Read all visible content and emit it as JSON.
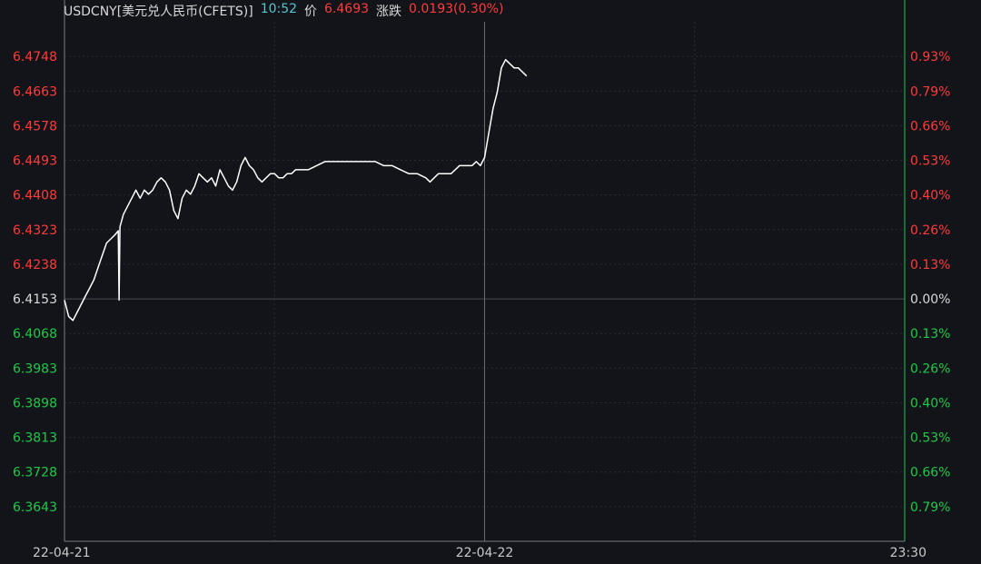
{
  "header": {
    "symbol": "USDCNY[美元兑人民币(CFETS)]",
    "time": "10:52",
    "price_label": "价",
    "price": "6.4693",
    "change_label": "涨跌",
    "change": "0.0193(0.30%)"
  },
  "colors": {
    "background": "#131419",
    "up": "#ff3b3b",
    "down": "#1ec94a",
    "neutral": "#d9d9d9",
    "line": "#ffffff",
    "grid": "#2a2c33",
    "time": "#56c5d0"
  },
  "chart_data": {
    "type": "line",
    "base_price": 6.4153,
    "ylim": [
      6.3558,
      6.4833
    ],
    "y_ticks_left": [
      "6.4748",
      "6.4663",
      "6.4578",
      "6.4493",
      "6.4408",
      "6.4323",
      "6.4238",
      "6.4153",
      "6.4068",
      "6.3983",
      "6.3898",
      "6.3813",
      "6.3728",
      "6.3643"
    ],
    "y_ticks_right": [
      "0.93%",
      "0.79%",
      "0.66%",
      "0.53%",
      "0.40%",
      "0.26%",
      "0.13%",
      "0.00%",
      "0.13%",
      "0.26%",
      "0.40%",
      "0.53%",
      "0.66%",
      "0.79%"
    ],
    "x_ticks": [
      "22-04-21",
      "22-04-22",
      "23:30"
    ],
    "x_range": [
      0,
      100
    ],
    "day_divider_x": 50,
    "grid": true,
    "series": [
      {
        "values": [
          [
            0.0,
            6.415
          ],
          [
            0.5,
            6.411
          ],
          [
            1.0,
            6.41
          ],
          [
            1.5,
            6.412
          ],
          [
            2.0,
            6.414
          ],
          [
            2.5,
            6.416
          ],
          [
            3.0,
            6.418
          ],
          [
            3.5,
            6.42
          ],
          [
            4.0,
            6.423
          ],
          [
            4.5,
            6.426
          ],
          [
            5.0,
            6.429
          ],
          [
            5.5,
            6.43
          ],
          [
            6.0,
            6.431
          ],
          [
            6.4,
            6.432
          ],
          [
            6.5,
            6.415
          ],
          [
            6.6,
            6.433
          ],
          [
            7.0,
            6.436
          ],
          [
            7.5,
            6.438
          ],
          [
            8.0,
            6.44
          ],
          [
            8.5,
            6.442
          ],
          [
            9.0,
            6.44
          ],
          [
            9.5,
            6.442
          ],
          [
            10.0,
            6.441
          ],
          [
            10.5,
            6.442
          ],
          [
            11.0,
            6.444
          ],
          [
            11.5,
            6.445
          ],
          [
            12.0,
            6.444
          ],
          [
            12.5,
            6.442
          ],
          [
            13.0,
            6.437
          ],
          [
            13.5,
            6.435
          ],
          [
            14.0,
            6.44
          ],
          [
            14.5,
            6.442
          ],
          [
            15.0,
            6.441
          ],
          [
            15.5,
            6.443
          ],
          [
            16.0,
            6.446
          ],
          [
            16.5,
            6.445
          ],
          [
            17.0,
            6.444
          ],
          [
            17.5,
            6.445
          ],
          [
            18.0,
            6.443
          ],
          [
            18.5,
            6.447
          ],
          [
            19.0,
            6.445
          ],
          [
            19.5,
            6.443
          ],
          [
            20.0,
            6.442
          ],
          [
            20.5,
            6.444
          ],
          [
            21.0,
            6.448
          ],
          [
            21.5,
            6.45
          ],
          [
            22.0,
            6.448
          ],
          [
            22.5,
            6.447
          ],
          [
            23.0,
            6.445
          ],
          [
            23.5,
            6.444
          ],
          [
            24.0,
            6.445
          ],
          [
            24.5,
            6.446
          ],
          [
            25.0,
            6.446
          ],
          [
            25.5,
            6.445
          ],
          [
            26.0,
            6.445
          ],
          [
            26.5,
            6.446
          ],
          [
            27.0,
            6.446
          ],
          [
            27.5,
            6.447
          ],
          [
            28.0,
            6.447
          ],
          [
            28.5,
            6.447
          ],
          [
            29.0,
            6.447
          ],
          [
            30.0,
            6.448
          ],
          [
            31.0,
            6.449
          ],
          [
            32.0,
            6.449
          ],
          [
            33.0,
            6.449
          ],
          [
            34.0,
            6.449
          ],
          [
            35.0,
            6.449
          ],
          [
            36.0,
            6.449
          ],
          [
            37.0,
            6.449
          ],
          [
            38.0,
            6.448
          ],
          [
            39.0,
            6.448
          ],
          [
            40.0,
            6.447
          ],
          [
            41.0,
            6.446
          ],
          [
            42.0,
            6.446
          ],
          [
            43.0,
            6.445
          ],
          [
            43.5,
            6.444
          ],
          [
            44.0,
            6.445
          ],
          [
            44.5,
            6.446
          ],
          [
            45.0,
            6.446
          ],
          [
            45.5,
            6.446
          ],
          [
            46.0,
            6.446
          ],
          [
            46.5,
            6.447
          ],
          [
            47.0,
            6.448
          ],
          [
            47.5,
            6.448
          ],
          [
            48.0,
            6.448
          ],
          [
            48.5,
            6.448
          ],
          [
            49.0,
            6.449
          ],
          [
            49.5,
            6.448
          ],
          [
            50.0,
            6.45
          ],
          [
            50.5,
            6.456
          ],
          [
            51.0,
            6.462
          ],
          [
            51.5,
            6.466
          ],
          [
            52.0,
            6.472
          ],
          [
            52.5,
            6.474
          ],
          [
            53.0,
            6.473
          ],
          [
            53.5,
            6.472
          ],
          [
            54.0,
            6.472
          ],
          [
            54.5,
            6.471
          ],
          [
            55.0,
            6.47
          ]
        ]
      }
    ]
  }
}
